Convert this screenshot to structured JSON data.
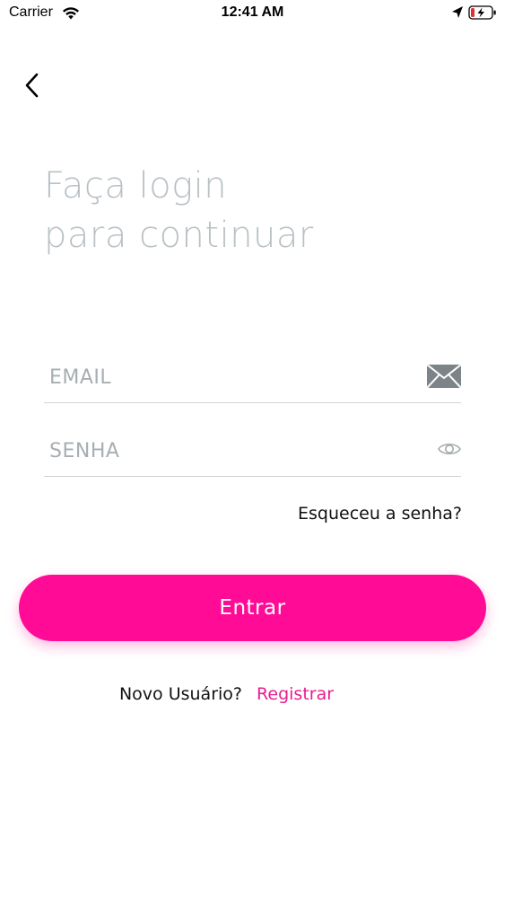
{
  "status_bar": {
    "carrier": "Carrier",
    "time": "12:41 AM"
  },
  "heading": {
    "line1": "Faça login",
    "line2": "para continuar"
  },
  "form": {
    "email_placeholder": "EMAIL",
    "email_value": "",
    "password_placeholder": "SENHA",
    "password_value": "",
    "forgot_label": "Esqueceu a senha?",
    "submit_label": "Entrar"
  },
  "footer": {
    "new_user_label": "Novo Usuário?",
    "register_label": "Registrar"
  },
  "colors": {
    "accent": "#ff0b95",
    "link": "#e81d8f",
    "heading": "#b9c1c5",
    "placeholder": "#a7aeb2",
    "divider": "#cfd3d6"
  },
  "icons": {
    "back": "chevron-left-icon",
    "email": "envelope-icon",
    "password": "eye-icon",
    "wifi": "wifi-icon",
    "location": "location-arrow-icon",
    "battery": "battery-charging-icon"
  }
}
